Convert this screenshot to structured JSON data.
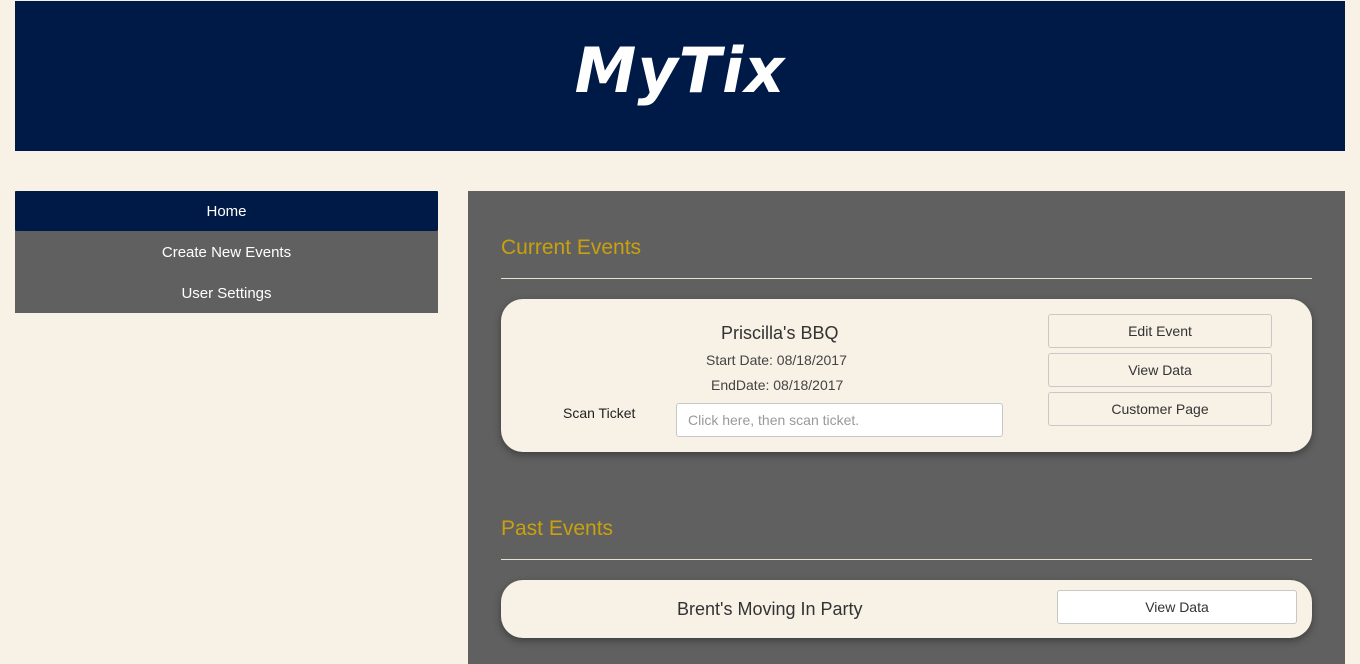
{
  "header": {
    "logo": "MyTix"
  },
  "sidebar": {
    "items": [
      {
        "label": "Home",
        "active": true
      },
      {
        "label": "Create New Events",
        "active": false
      },
      {
        "label": "User Settings",
        "active": false
      }
    ]
  },
  "current_events": {
    "title": "Current Events",
    "events": [
      {
        "name": "Priscilla's BBQ",
        "start_date": "Start Date: 08/18/2017",
        "end_date": "EndDate: 08/18/2017",
        "scan_label": "Scan Ticket",
        "scan_placeholder": "Click here, then scan ticket.",
        "buttons": [
          "Edit Event",
          "View Data",
          "Customer Page"
        ]
      }
    ]
  },
  "past_events": {
    "title": "Past Events",
    "events": [
      {
        "name": "Brent's Moving In Party",
        "button": "View Data"
      }
    ]
  },
  "colors": {
    "navy": "#001a47",
    "panel_gray": "#606060",
    "cream": "#f7f1e6",
    "gold": "#c9a00e"
  }
}
